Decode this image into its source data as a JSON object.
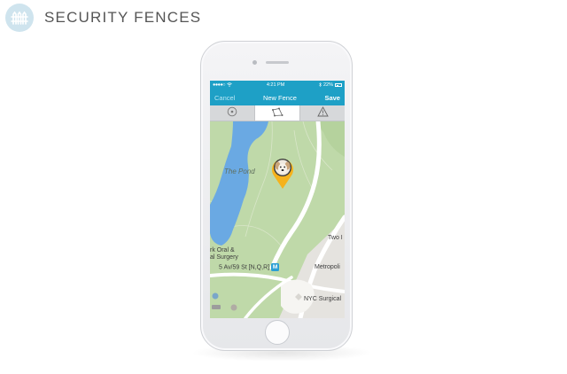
{
  "header": {
    "title": "SECURITY FENCES",
    "logo_icon": "fence-icon",
    "logo_bg": "#cfe4ee"
  },
  "phone": {
    "status": {
      "signal": "●●●●○",
      "time": "4:21 PM",
      "battery": "22%"
    },
    "nav": {
      "cancel": "Cancel",
      "title": "New Fence",
      "save": "Save"
    },
    "tabs": [
      {
        "icon": "circle-fence-icon",
        "active": false
      },
      {
        "icon": "polygon-fence-icon",
        "active": true
      },
      {
        "icon": "warning-icon",
        "active": false
      }
    ],
    "map": {
      "labels": {
        "pond": "The Pond",
        "two": "Two I",
        "oral1": "rk Oral &",
        "oral2": "al Surgery",
        "station": "5 Av/59 St [N,Q,R]",
        "station_badge": "M",
        "metro": "Metropoli",
        "nyc": "NYC Surgical"
      },
      "pin_icon": "dog-location-pin-icon"
    },
    "colors": {
      "accent": "#1ea0c6",
      "park": "#bfd9a9",
      "water": "#6aa9e3",
      "pin": "#f5b21c"
    }
  }
}
